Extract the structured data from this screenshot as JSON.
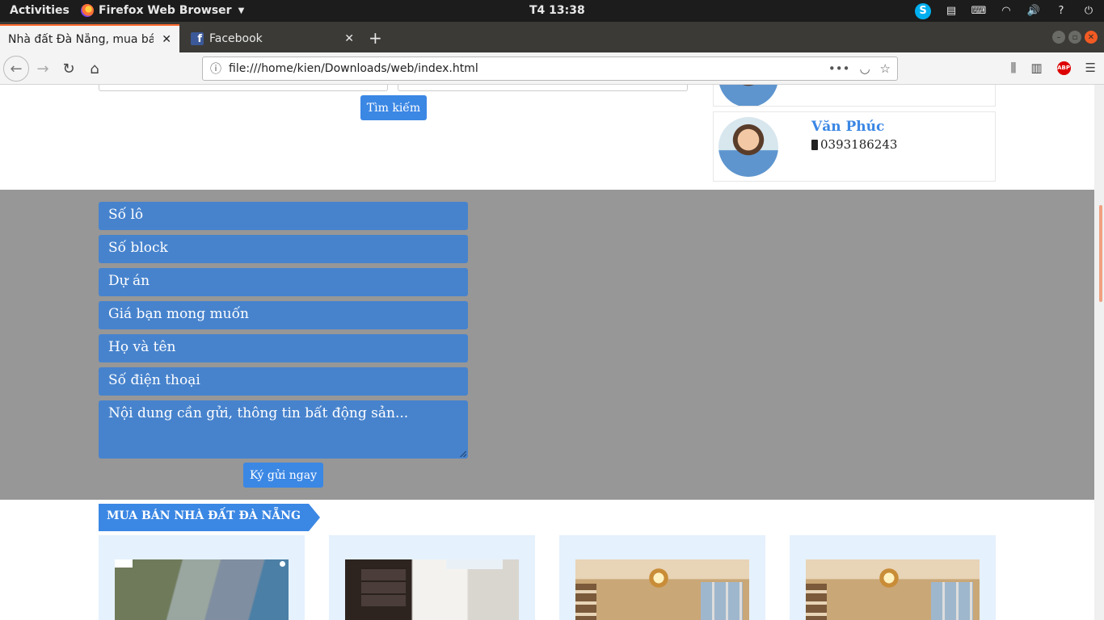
{
  "system_bar": {
    "activities": "Activities",
    "app_name": "Firefox Web Browser",
    "clock": "T4 13:38"
  },
  "browser": {
    "tabs": [
      {
        "title": "Nhà đất Đà Nẵng, mua bán nhà đất Đà Nẵng",
        "active": true
      },
      {
        "title": "Facebook",
        "active": false
      }
    ],
    "url": "file:///home/kien/Downloads/web/index.html"
  },
  "search": {
    "button_label": "Tìm kiếm"
  },
  "agents": [
    {
      "name": "",
      "phone": ""
    },
    {
      "name": "Văn Phúc",
      "phone": "0393186243"
    }
  ],
  "consign_form": {
    "lot": "Số lô",
    "block": "Số block",
    "project": "Dự án",
    "price": "Giá bạn mong muốn",
    "fullname": "Họ và tên",
    "phone": "Số điện thoại",
    "content": "Nội dung cần gửi, thông tin bất động sản...",
    "submit_label": "Ký gửi ngay"
  },
  "listing_section": {
    "heading": "MUA BÁN NHÀ ĐẤT ĐÀ NẴNG"
  },
  "colors": {
    "accent_blue": "#3b87e4",
    "field_blue": "#4783cd",
    "form_bg": "#979797",
    "card_bg": "#e5f1fd"
  }
}
